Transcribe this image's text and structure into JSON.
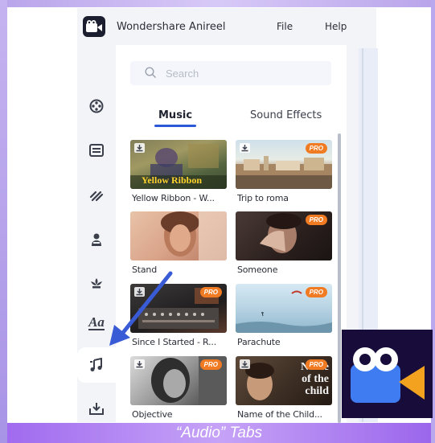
{
  "app": {
    "title": "Wondershare Anireel",
    "menu": {
      "file": "File",
      "help": "Help"
    }
  },
  "rail": {
    "items": [
      {
        "icon": "film-reel-icon",
        "active": false
      },
      {
        "icon": "template-icon",
        "active": false
      },
      {
        "icon": "scene-icon",
        "active": false
      },
      {
        "icon": "character-icon",
        "active": false
      },
      {
        "icon": "prop-icon",
        "active": false
      },
      {
        "icon": "text-icon",
        "text": "Aa",
        "active": false
      },
      {
        "icon": "music-note-icon",
        "active": true
      },
      {
        "icon": "import-icon",
        "active": false
      }
    ]
  },
  "panel": {
    "search": {
      "placeholder": "Search"
    },
    "tabs": [
      {
        "label": "Music",
        "active": true
      },
      {
        "label": "Sound Effects",
        "active": false
      }
    ],
    "items": [
      {
        "label": "Yellow Ribbon - W...",
        "overlay": "Yellow Ribbon",
        "download": true,
        "pro": false
      },
      {
        "label": "Trip to roma",
        "download": true,
        "pro": true,
        "pro_label": "PRO"
      },
      {
        "label": "Stand",
        "download": false,
        "pro": false
      },
      {
        "label": "Someone",
        "download": false,
        "pro": true,
        "pro_label": "PRO"
      },
      {
        "label": "Since I Started - R...",
        "download": true,
        "pro": true,
        "pro_label": "PRO"
      },
      {
        "label": "Parachute",
        "download": false,
        "pro": true,
        "pro_label": "PRO"
      },
      {
        "label": "Objective",
        "download": true,
        "pro": true,
        "pro_label": "PRO"
      },
      {
        "label": "Name of the Child...",
        "overlay_lines": [
          "Name",
          "of the",
          "child"
        ],
        "download": true,
        "pro": true,
        "pro_label": "PRO"
      }
    ]
  },
  "caption": "“Audio” Tabs",
  "colors": {
    "accent": "#2a58d9",
    "pro": "#f07b22",
    "caption": "#b385f2",
    "arrow": "#3a5bd6"
  }
}
